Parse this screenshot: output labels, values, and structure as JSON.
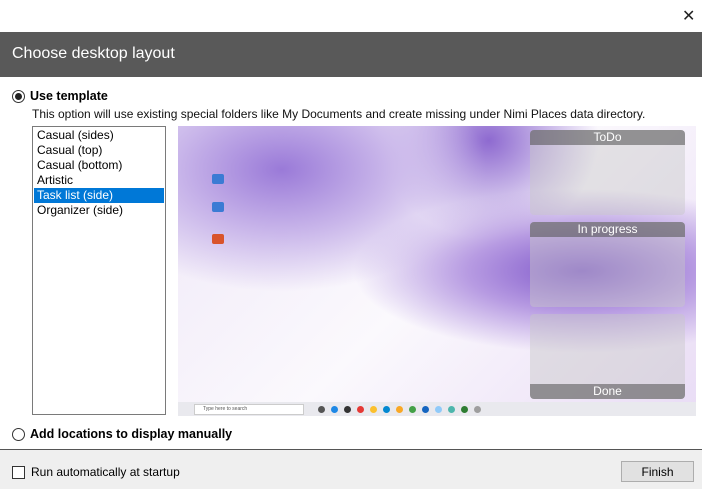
{
  "window": {
    "close_icon": "close-icon"
  },
  "header": {
    "title": "Choose desktop layout"
  },
  "template_option": {
    "label": "Use template",
    "description": "This option will use existing special folders like My Documents and create missing under Nimi Places data directory.",
    "selected": true
  },
  "templates": [
    {
      "label": "Casual (sides)"
    },
    {
      "label": "Casual (top)"
    },
    {
      "label": "Casual (bottom)"
    },
    {
      "label": "Artistic"
    },
    {
      "label": "Task list (side)",
      "selected": true
    },
    {
      "label": "Organizer (side)"
    }
  ],
  "preview": {
    "panels": [
      "ToDo",
      "In progress",
      "Done"
    ],
    "taskbar_search": "Type here to search"
  },
  "manual_option": {
    "label": "Add locations to display manually",
    "selected": false
  },
  "footer": {
    "startup_label": "Run automatically at startup",
    "startup_checked": false,
    "finish_label": "Finish"
  }
}
